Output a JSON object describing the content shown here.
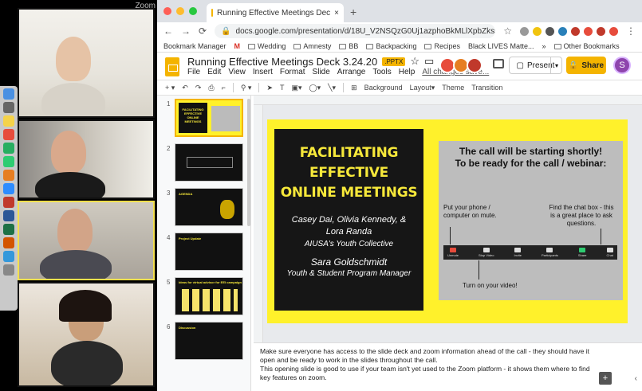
{
  "zoom": {
    "title": "Zoom",
    "controls": {
      "more": "···",
      "video": "▭",
      "stop": "✕",
      "pause": "∥",
      "check": "✓"
    }
  },
  "browser": {
    "tab_title": "Running Effective Meetings Dec",
    "tab_close": "×",
    "new_tab": "+",
    "url": "docs.google.com/presentation/d/18U_V2NSQzG0Uj1azphoBkMLlXpbZkssc/edit#sli...",
    "bookmarks": [
      "Bookmark Manager",
      "M",
      "Wedding",
      "Amnesty",
      "BB",
      "Backpacking",
      "Recipes",
      "Black LIVES Matte...",
      "»",
      "Other Bookmarks"
    ]
  },
  "doc": {
    "title": "Running Effective Meetings Deck 3.24.20",
    "badge": ".PPTX",
    "menus": [
      "File",
      "Edit",
      "View",
      "Insert",
      "Format",
      "Slide",
      "Arrange",
      "Tools",
      "Help"
    ],
    "changes": "All changes save...",
    "present_label": "Present",
    "share_label": "Share",
    "avatar_letter": "S"
  },
  "toolbar": {
    "items": [
      "Background",
      "Layout▾",
      "Theme",
      "Transition"
    ]
  },
  "thumbnails": [
    {
      "num": "1",
      "label": "FACILITATING EFFECTIVE ONLINE MEETINGS"
    },
    {
      "num": "2",
      "label": ""
    },
    {
      "num": "3",
      "label": "AGENDA"
    },
    {
      "num": "4",
      "label": "Project Update"
    },
    {
      "num": "5",
      "label": "Ideas for virtual advisor for EEI campaign"
    },
    {
      "num": "6",
      "label": "Discussion"
    }
  ],
  "slide": {
    "title": "FACILITATING\nEFFECTIVE\nONLINE MEETINGS",
    "names": "Casey Dai, Olivia Kennedy, &\nLora Randa",
    "org": "AIUSA's Youth Collective",
    "presenter": "Sara Goldschmidt",
    "role": "Youth & Student Program Manager",
    "right_title_1": "The call will be starting shortly!",
    "right_title_2": "To be ready for the call / webinar:",
    "tip_phone": "Put your phone / computer on mute.",
    "tip_chat": "Find the chat box - this is a great place to ask questions.",
    "tip_video": "Turn on your video!",
    "zoom_controls": [
      "Unmute",
      "Stop Video",
      "Invite",
      "Participants",
      "Share",
      "Chat"
    ]
  },
  "notes": {
    "line1": "Make sure everyone has access to the slide deck and zoom information ahead of the call - they should have it",
    "line2": "open and be ready to work in the slides throughout the call.",
    "line3": "This opening slide is good to use if your team isn't yet used to the Zoom platform - it shows them where to find",
    "line4": "key features on zoom."
  },
  "colors": {
    "accent": "#f4b400",
    "slide_bg": "#fff12b",
    "title_yellow": "#f6e83a"
  }
}
